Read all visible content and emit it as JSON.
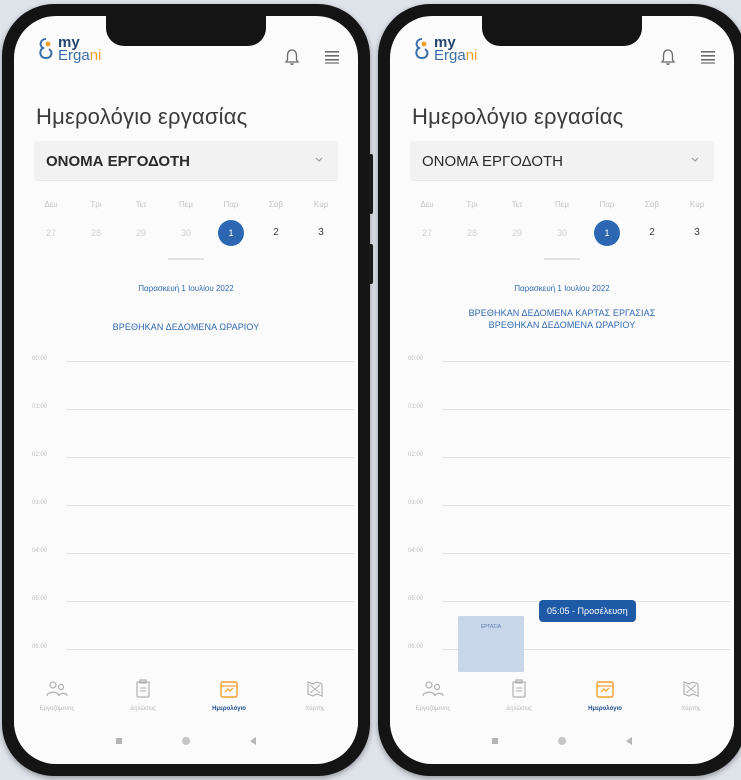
{
  "brand": {
    "my": "my",
    "ergani_main": "Erga",
    "ergani_accent": "ni"
  },
  "title": "Ημερολόγιο εργασίας",
  "weekdays": [
    "Δευ",
    "Τρι",
    "Τετ",
    "Πεμ",
    "Παρ",
    "Σαβ",
    "Κυρ"
  ],
  "dates": [
    "27",
    "28",
    "29",
    "30",
    "1",
    "2",
    "3"
  ],
  "selected_date": "1",
  "hours": [
    "00:00",
    "01:00",
    "02:00",
    "03:00",
    "04:00",
    "05:00",
    "06:00"
  ],
  "left_screen": {
    "employer": "ΟΝΟΜΑ ΕΡΓΟΔΟΤΗ",
    "date_line": "Παρασκευή 1 Ιουλίου 2022",
    "status_1": "ΒΡΕΘΗΚΑΝ ΔΕΔΟΜΕΝΑ ΩΡΑΡΙΟΥ"
  },
  "right_screen": {
    "employer": "ΟΝΟΜΑ ΕΡΓΟΔΟΤΗ",
    "date_line": "Παρασκευή 1 Ιουλίου 2022",
    "status_1": "ΒΡΕΘΗΚΑΝ ΔΕΔΟΜΕΝΑ ΚΑΡΤΑΣ ΕΡΓΑΣΙΑΣ",
    "status_2": "ΒΡΕΘΗΚΑΝ ΔΕΔΟΜΕΝΑ ΩΡΑΡΙΟΥ",
    "work_block_label": "ΕΡΓΑΣΙΑ",
    "arrival_chip": "05:05 - Προσέλευση"
  },
  "nav": [
    {
      "label": "Εργαζόμενος",
      "icon": "users-icon"
    },
    {
      "label": "Δηλώσεις",
      "icon": "clipboard-icon"
    },
    {
      "label": "Ημερολόγιο",
      "icon": "calendar-icon"
    },
    {
      "label": "Χάρτης",
      "icon": "map-icon"
    }
  ],
  "colors": {
    "primary": "#2e67b1",
    "accent": "#f0a02a",
    "brand_dark": "#27466e",
    "chip": "#1f5aa6",
    "work_block": "#c8d6ea"
  }
}
